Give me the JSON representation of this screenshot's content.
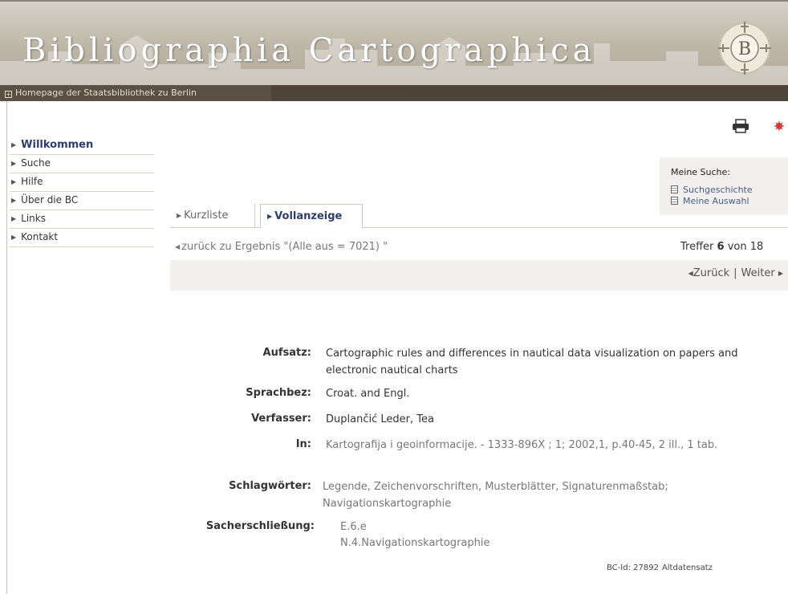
{
  "header": {
    "title": "Bibliographia Cartographica",
    "logo_letter": "B",
    "home_link": "Homepage der Staatsbibliothek zu Berlin",
    "colors": {
      "banner": "#bdb6a8",
      "strip": "#4e4439",
      "accent": "#2c3d6e"
    }
  },
  "nav": {
    "items": [
      {
        "label": "Willkommen",
        "active": true
      },
      {
        "label": "Suche"
      },
      {
        "label": "Hilfe"
      },
      {
        "label": "Über die BC"
      },
      {
        "label": "Links"
      },
      {
        "label": "Kontakt"
      }
    ]
  },
  "toolbar": {
    "print_icon": "printer-icon",
    "extra_icon": "red-bug-icon"
  },
  "meine_suche": {
    "title": "Meine Suche:",
    "links": [
      "Suchgeschichte",
      "Meine Auswahl"
    ]
  },
  "tabs": [
    {
      "label": "Kurzliste"
    },
    {
      "label": "Vollanzeige",
      "active": true
    }
  ],
  "results": {
    "back_link": "zurück zu Ergebnis \"(Alle aus = 7021) \"",
    "hits_prefix": "Treffer",
    "hits_current": "6",
    "hits_suffix": "von 18",
    "prev_label": "Zurück",
    "separator": "|",
    "next_label": "Weiter"
  },
  "record": {
    "aufsatz": {
      "label": "Aufsatz:",
      "value": "Cartographic rules and differences in nautical data visualization on papers and electronic nautical charts"
    },
    "sprachbez": {
      "label": "Sprachbez:",
      "value": "Croat. and Engl."
    },
    "verfasser": {
      "label": "Verfasser:",
      "value": "Duplančić Leder, Tea"
    },
    "in": {
      "label": "In:",
      "value": "Kartografija i geoinformacije. - 1333-896X ; 1; 2002,1, p.40-45, 2 ill., 1 tab."
    },
    "schlagwoerter": {
      "label": "Schlagwörter:",
      "value": "Legende, Zeichenvorschriften, Musterblätter, Signaturenmaßstab; Navigationskartographie"
    },
    "sacherschliessung": {
      "label": "Sacherschließung:",
      "line1": "E.6.e",
      "line2": "N.4.Navigationskartographie"
    }
  },
  "footer": {
    "bc_id": "BC-Id: 27892",
    "status": "Altdatensatz"
  }
}
